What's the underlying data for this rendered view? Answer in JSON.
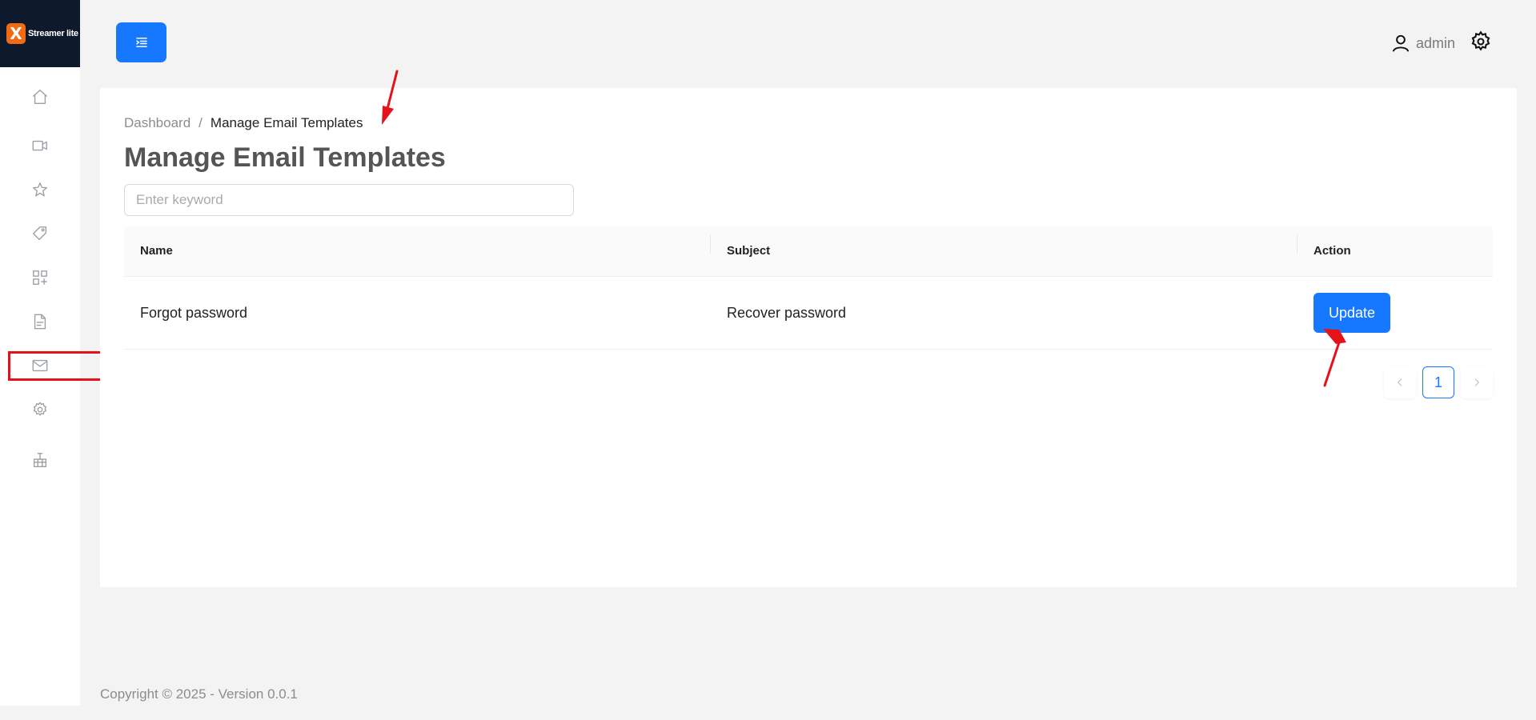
{
  "app": {
    "logo_mark": "X",
    "logo_text": "Streamer lite"
  },
  "sidebar": {
    "items": [
      {
        "name": "home",
        "icon": "home-icon"
      },
      {
        "name": "videos",
        "icon": "video-icon"
      },
      {
        "name": "favorites",
        "icon": "star-icon"
      },
      {
        "name": "tags",
        "icon": "tag-icon"
      },
      {
        "name": "categories",
        "icon": "apps-icon"
      },
      {
        "name": "pages",
        "icon": "file-icon"
      },
      {
        "name": "email-templates",
        "icon": "mail-icon",
        "highlighted": true
      },
      {
        "name": "settings",
        "icon": "gear-icon"
      },
      {
        "name": "sitemap",
        "icon": "sitemap-icon"
      }
    ]
  },
  "header": {
    "user_name": "admin"
  },
  "breadcrumb": {
    "items": [
      "Dashboard",
      "/",
      "Manage Email Templates"
    ]
  },
  "page": {
    "title": "Manage Email Templates"
  },
  "search": {
    "placeholder": "Enter keyword",
    "value": ""
  },
  "table": {
    "columns": [
      "Name",
      "Subject",
      "Action"
    ],
    "rows": [
      {
        "name": "Forgot password",
        "subject": "Recover password",
        "action_label": "Update"
      }
    ]
  },
  "pagination": {
    "current_page": "1"
  },
  "footer": {
    "text": "Copyright © 2025 - Version 0.0.1"
  },
  "colors": {
    "primary": "#1677ff",
    "annotation_red": "#e6121a",
    "logo_bg": "#0c1a2b",
    "logo_accent": "#f26b12"
  }
}
